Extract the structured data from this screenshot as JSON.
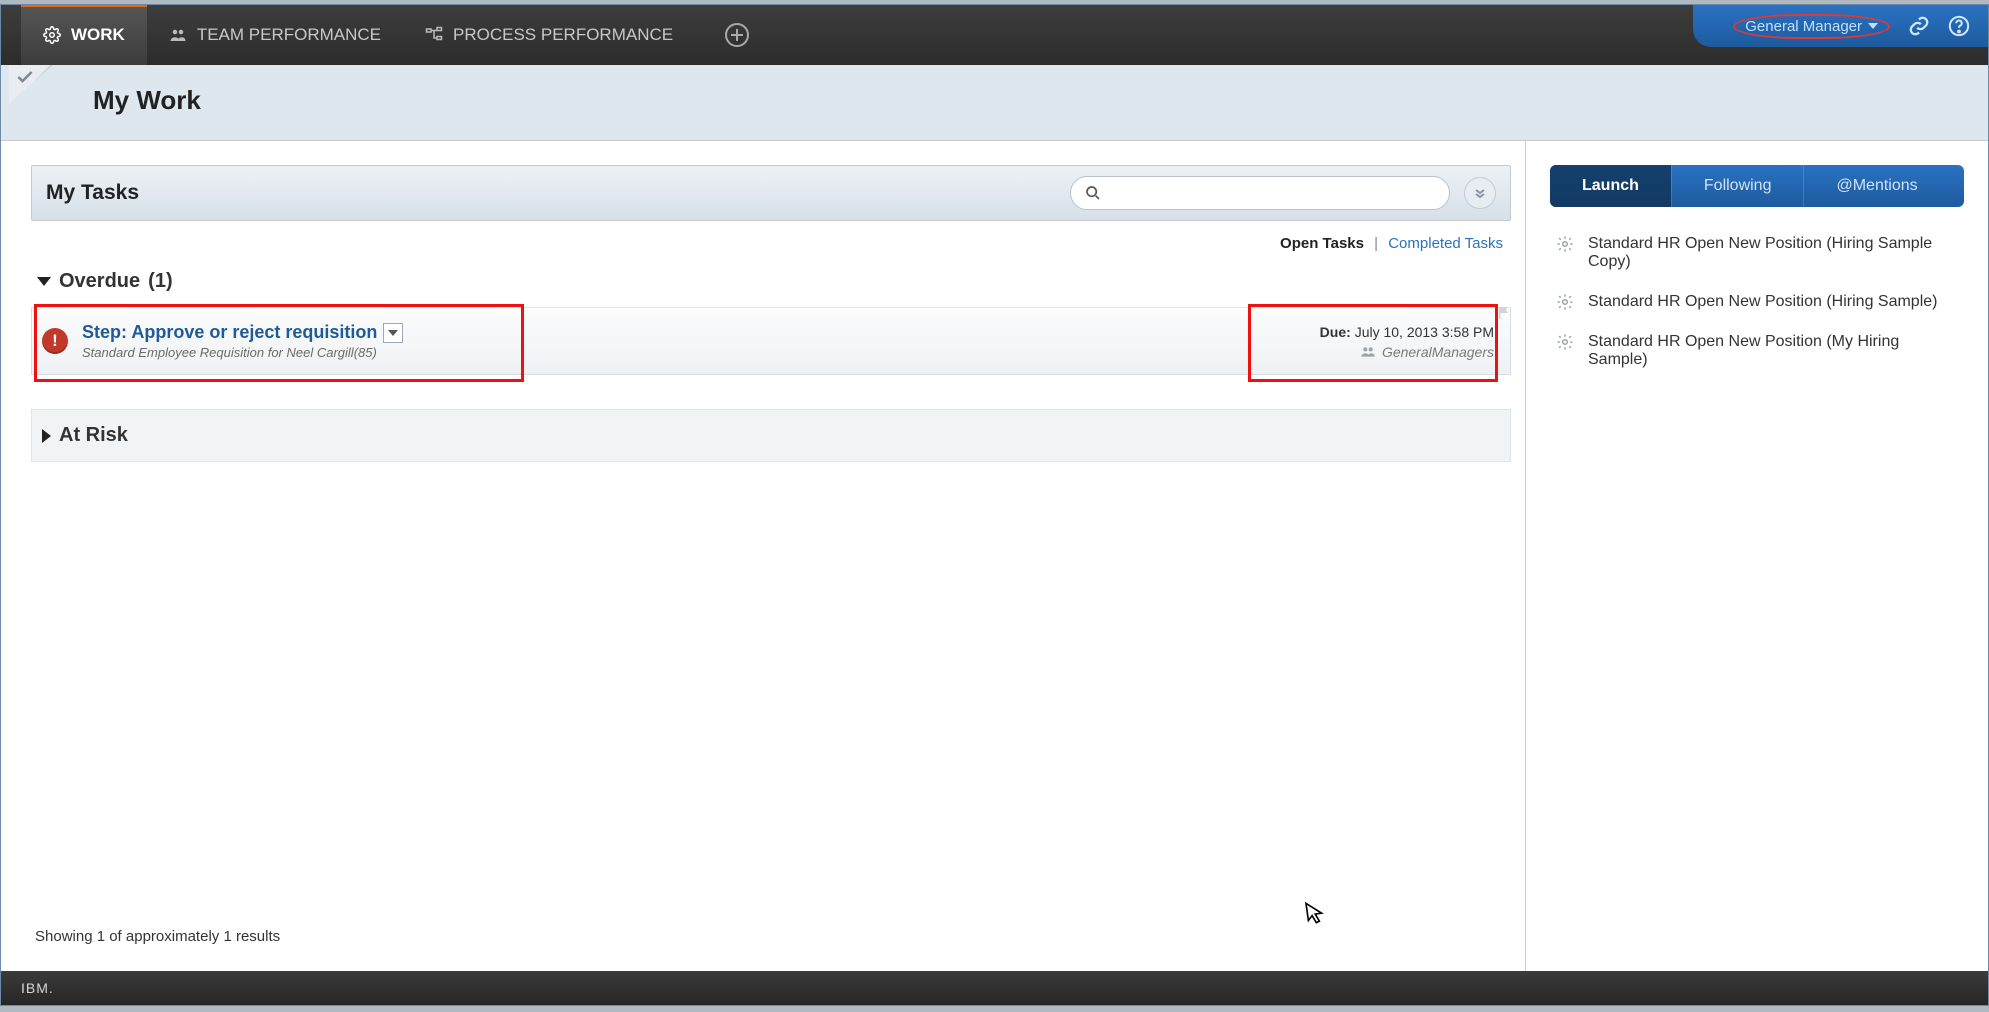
{
  "nav": {
    "tabs": [
      {
        "label": "WORK",
        "icon": "gear-icon"
      },
      {
        "label": "TEAM PERFORMANCE",
        "icon": "people-icon"
      },
      {
        "label": "PROCESS PERFORMANCE",
        "icon": "branch-icon"
      }
    ],
    "user_label": "General Manager"
  },
  "page": {
    "title": "My Work"
  },
  "tasks_panel": {
    "title": "My Tasks",
    "search_placeholder": "",
    "filters": {
      "open": "Open Tasks",
      "completed": "Completed Tasks",
      "sep": "|"
    },
    "sections": {
      "overdue": {
        "label": "Overdue",
        "count": "(1)"
      },
      "at_risk": {
        "label": "At Risk"
      }
    },
    "task": {
      "title": "Step: Approve or reject requisition",
      "subtitle": "Standard Employee Requisition for Neel Cargill(85)",
      "due_label": "Due:",
      "due_value": "July 10, 2013 3:58 PM",
      "group": "GeneralManagers"
    },
    "results_footer": "Showing 1 of approximately 1 results"
  },
  "side": {
    "tabs": {
      "launch": "Launch",
      "following": "Following",
      "mentions": "@Mentions"
    },
    "launch_items": [
      "Standard HR Open New Position (Hiring Sample Copy)",
      "Standard HR Open New Position (Hiring Sample)",
      "Standard HR Open New Position (My Hiring Sample)"
    ]
  },
  "footer": {
    "brand": "IBM."
  }
}
